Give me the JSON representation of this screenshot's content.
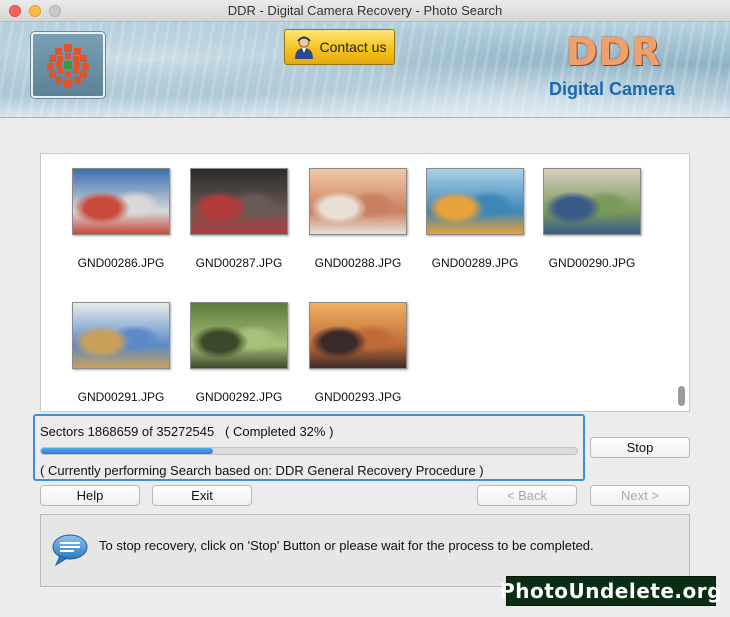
{
  "window": {
    "title": "DDR - Digital Camera Recovery - Photo Search"
  },
  "header": {
    "contact_label": "Contact us",
    "brand_title": "DDR",
    "brand_subtitle": "Digital Camera"
  },
  "gallery": {
    "items": [
      {
        "name": "GND00286.JPG",
        "colors": [
          "#3a6fb0",
          "#d8d8d8",
          "#c94a3a"
        ]
      },
      {
        "name": "GND00287.JPG",
        "colors": [
          "#2b2b2b",
          "#6a5a55",
          "#b23c3c"
        ]
      },
      {
        "name": "GND00288.JPG",
        "colors": [
          "#f2c9a8",
          "#c98060",
          "#e8e0d4"
        ]
      },
      {
        "name": "GND00289.JPG",
        "colors": [
          "#a9d0e8",
          "#3e86b8",
          "#e8a23a"
        ]
      },
      {
        "name": "GND00290.JPG",
        "colors": [
          "#d8cfc0",
          "#7a9a5a",
          "#3a5a8a"
        ]
      },
      {
        "name": "GND00291.JPG",
        "colors": [
          "#e8ecec",
          "#5a8ac8",
          "#c8a05a"
        ]
      },
      {
        "name": "GND00292.JPG",
        "colors": [
          "#5a7a3a",
          "#a8c07a",
          "#3a4a2a"
        ]
      },
      {
        "name": "GND00293.JPG",
        "colors": [
          "#f0b060",
          "#c06a3a",
          "#3a2a2a"
        ]
      }
    ]
  },
  "progress": {
    "sectors_text": "Sectors 1868659 of 35272545   ( Completed 32% )",
    "percent": 32,
    "process_text": "( Currently performing Search based on: DDR General Recovery Procedure )"
  },
  "buttons": {
    "stop": "Stop",
    "help": "Help",
    "exit": "Exit",
    "back": "< Back",
    "next": "Next >"
  },
  "info": {
    "message": "To stop recovery, click on 'Stop' Button or please wait for the process to be completed."
  },
  "watermark": {
    "text": "PhotoUndelete.org"
  },
  "colors": {
    "accent": "#3d8fd6",
    "brand_orange": "#f0a06a",
    "brand_blue": "#1a68b5"
  }
}
